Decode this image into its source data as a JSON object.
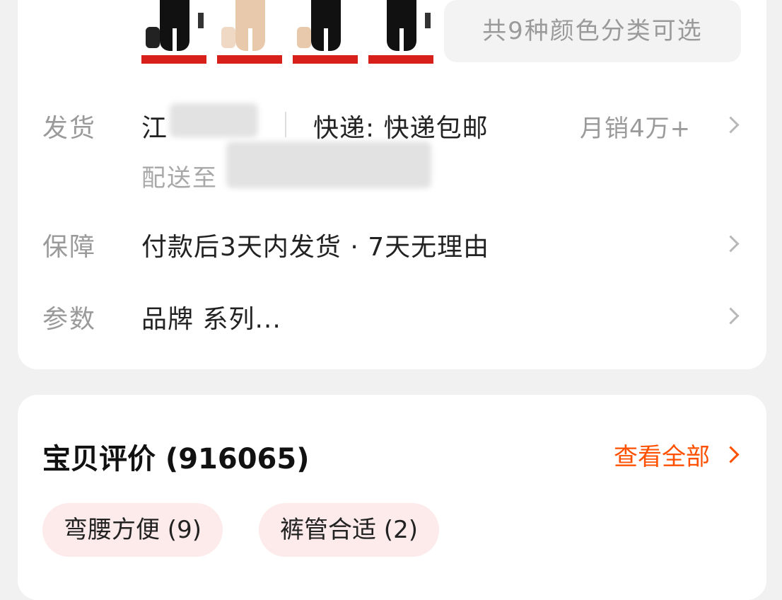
{
  "product_info": {
    "color_count_text": "共9种颜色分类可选",
    "thumbnails": [
      {
        "name": "black-shaper-1",
        "color": "#111111"
      },
      {
        "name": "nude-shaper",
        "color": "#e9c9ac"
      },
      {
        "name": "black-shaper-2",
        "color": "#111111"
      },
      {
        "name": "black-shaper-3",
        "color": "#111111"
      }
    ],
    "shipping": {
      "label": "发货",
      "origin_visible": "江",
      "express_text": "快递: 快递包邮",
      "monthly_sales": "月销4万+",
      "deliver_to_label": "配送至"
    },
    "guarantee": {
      "label": "保障",
      "text": "付款后3天内发货 · 7天无理由"
    },
    "params": {
      "label": "参数",
      "text": "品牌 系列..."
    }
  },
  "reviews": {
    "title": "宝贝评价 (916065)",
    "view_all_label": "查看全部",
    "tags": [
      {
        "label": "弯腰方便 (9)"
      },
      {
        "label": "裤管合适 (2)"
      }
    ]
  }
}
